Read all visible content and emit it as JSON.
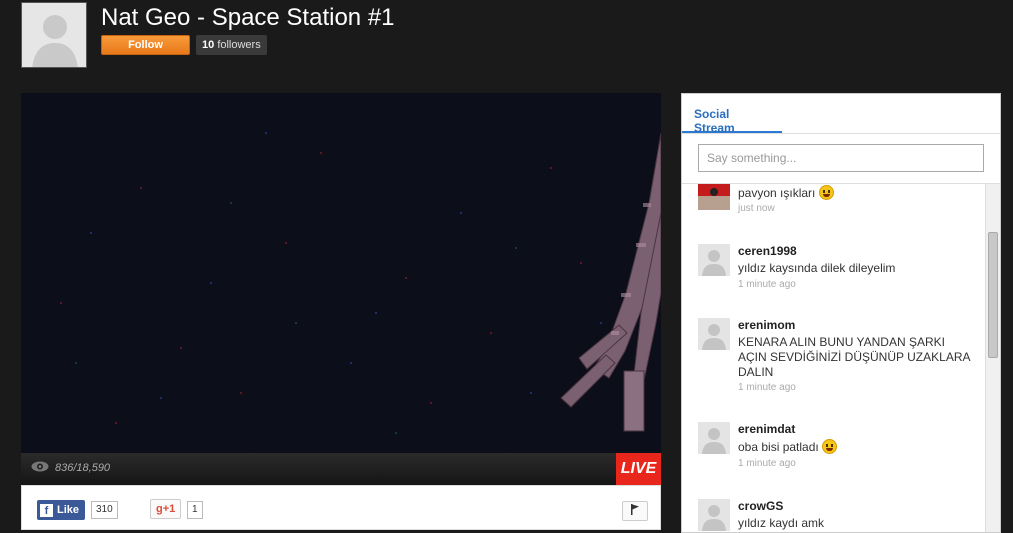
{
  "channel": {
    "title": "Nat Geo - Space Station #1",
    "follow_label": "Follow",
    "followers_count": "10",
    "followers_label": "followers"
  },
  "video": {
    "viewers": "836/18,590",
    "live_label": "LIVE"
  },
  "share": {
    "like_label": "Like",
    "like_count": "310",
    "gplus_label": "g+1",
    "gplus_count": "1"
  },
  "stream": {
    "tab_label": "Social Stream",
    "input_placeholder": "Say something...",
    "posts": [
      {
        "user": "",
        "text": "pavyon ışıkları",
        "emoji": true,
        "time": "just now"
      },
      {
        "user": "ceren1998",
        "text": "yıldız kaysında dilek dileyelim",
        "emoji": false,
        "time": "1 minute ago"
      },
      {
        "user": "erenimom",
        "text": "KENARA ALIN BUNU YANDAN ŞARKI AÇIN SEVDİĞİNİZİ DÜŞÜNÜP UZAKLARA DALIN",
        "emoji": false,
        "time": "1 minute ago"
      },
      {
        "user": "erenimdat",
        "text": "oba bisi patladı",
        "emoji": true,
        "time": "1 minute ago"
      },
      {
        "user": "crowGS",
        "text": "yıldız kaydı amk",
        "emoji": false,
        "time": ""
      }
    ]
  },
  "colors": {
    "accent_orange": "#f08a2a",
    "live_red": "#e8261c",
    "tab_blue": "#2a6fbd",
    "facebook_blue": "#3b5998"
  }
}
